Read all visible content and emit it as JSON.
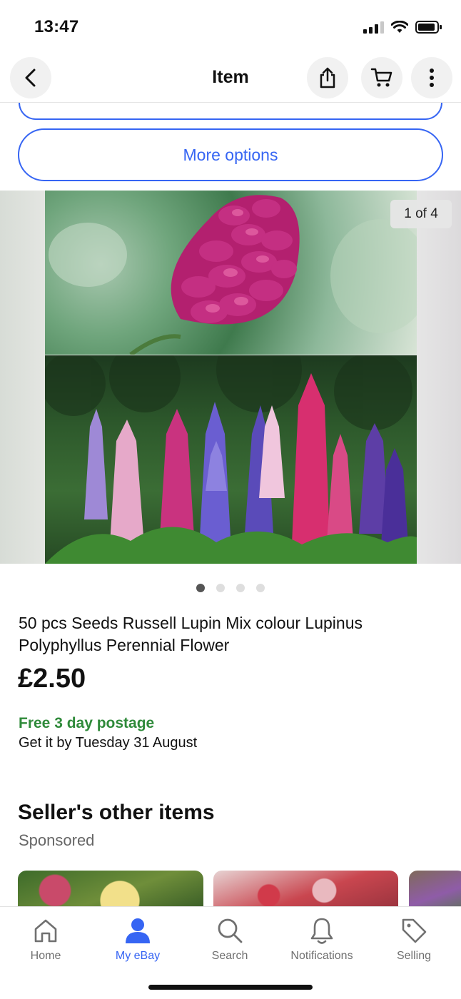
{
  "status": {
    "time": "13:47"
  },
  "header": {
    "title": "Item"
  },
  "buttons": {
    "more_options": "More options"
  },
  "gallery": {
    "counter": "1 of 4",
    "image_count": 4,
    "active_index": 0
  },
  "product": {
    "title": "50 pcs Seeds Russell Lupin Mix colour Lupinus Polyphyllus Perennial Flower",
    "price": "£2.50",
    "shipping": "Free 3 day postage",
    "delivery": "Get it by Tuesday 31 August"
  },
  "seller_section": {
    "title": "Seller's other items",
    "subtitle": "Sponsored"
  },
  "tabs": [
    {
      "label": "Home",
      "icon": "home-icon",
      "active": false
    },
    {
      "label": "My eBay",
      "icon": "person-icon",
      "active": true
    },
    {
      "label": "Search",
      "icon": "search-icon",
      "active": false
    },
    {
      "label": "Notifications",
      "icon": "bell-icon",
      "active": false
    },
    {
      "label": "Selling",
      "icon": "tag-icon",
      "active": false
    }
  ],
  "colors": {
    "accent": "#3665f3",
    "shipping_green": "#2f8a3a",
    "inactive_tab": "#707070"
  }
}
